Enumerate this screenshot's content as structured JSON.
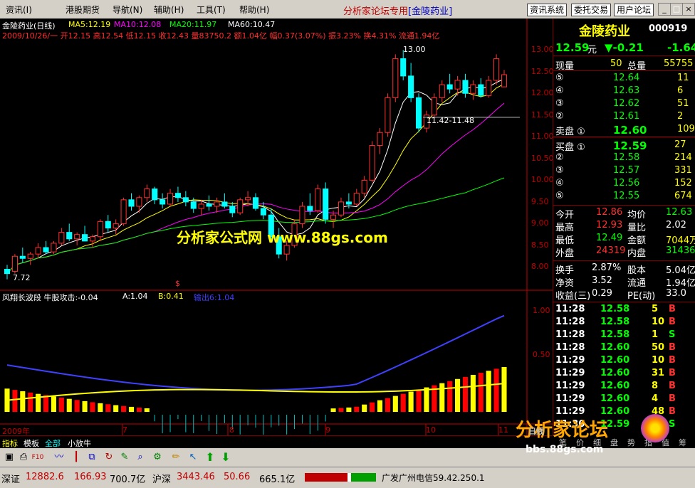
{
  "menubar": {
    "items": [
      "资讯(I)",
      "港股期货",
      "导航(N)",
      "辅助(H)",
      "工具(T)",
      "帮助(H)"
    ],
    "center_title": "分析家论坛专用",
    "center_stock": "[金陵药业]",
    "buttons": [
      "资讯系统",
      "委托交易",
      "用户论坛"
    ]
  },
  "chart": {
    "title": "金陵药业(日线)",
    "ma": [
      {
        "label": "MA5:12.19",
        "color": "#ffffff"
      },
      {
        "label": "MA10:12.08",
        "color": "#ffff00"
      },
      {
        "label": "MA20:11.97",
        "color": "#ff00ff"
      },
      {
        "label": "MA60:10.47",
        "color": "#00ff00"
      }
    ],
    "info_line": "2009/10/26/一 开12.15 高12.54 低12.15 收12.43 量83750.2 额1.04亿 幅0.37(3.07%) 振3.23% 换4.31% 流通1.94亿",
    "annotations": {
      "high": "13.00",
      "low": "7.72",
      "range": "11.42-11.48",
      "mark": "$"
    },
    "price_ticks": [
      "13.00",
      "12.50",
      "12.00",
      "11.50",
      "11.00",
      "10.50",
      "10.00",
      "9.50",
      "9.00",
      "8.50",
      "8.00"
    ],
    "indicator_title": "风翔长波段  牛股攻击:-0.04",
    "indicator_a": "A:1.04",
    "indicator_b": "B:0.41",
    "indicator_c": "输出6:1.04",
    "indicator_ticks": [
      "1.00",
      "0.50"
    ],
    "date_labels": [
      "2009年",
      "7",
      "8",
      "9",
      "10",
      "11"
    ],
    "watermark_center": "分析家公式网 www.88gs.com",
    "chart_data": {
      "type": "candlestick",
      "title": "金陵药业(日线)",
      "ylim": [
        7.5,
        13.2
      ],
      "candles_ohlc": [
        [
          7.95,
          8.05,
          7.72,
          7.85
        ],
        [
          7.9,
          8.3,
          7.85,
          8.25
        ],
        [
          8.25,
          8.45,
          8.1,
          8.2
        ],
        [
          8.2,
          8.35,
          8.05,
          8.3
        ],
        [
          8.3,
          8.55,
          8.2,
          8.45
        ],
        [
          8.45,
          8.6,
          8.3,
          8.35
        ],
        [
          8.35,
          8.6,
          8.3,
          8.55
        ],
        [
          8.55,
          8.9,
          8.5,
          8.8
        ],
        [
          8.8,
          9.0,
          8.6,
          8.65
        ],
        [
          8.65,
          8.8,
          8.5,
          8.75
        ],
        [
          8.75,
          8.95,
          8.65,
          8.6
        ],
        [
          8.6,
          8.75,
          8.45,
          8.7
        ],
        [
          8.7,
          9.1,
          8.6,
          9.05
        ],
        [
          9.05,
          9.2,
          8.8,
          8.9
        ],
        [
          8.9,
          9.1,
          8.75,
          9.0
        ],
        [
          9.0,
          9.6,
          8.95,
          9.55
        ],
        [
          9.55,
          9.7,
          9.3,
          9.4
        ],
        [
          9.4,
          9.65,
          9.25,
          9.6
        ],
        [
          9.6,
          9.9,
          9.5,
          9.8
        ],
        [
          9.8,
          9.85,
          9.45,
          9.55
        ],
        [
          9.55,
          9.7,
          9.35,
          9.45
        ],
        [
          9.45,
          9.8,
          9.4,
          9.7
        ],
        [
          9.7,
          9.85,
          9.5,
          9.6
        ],
        [
          9.6,
          9.75,
          9.4,
          9.5
        ],
        [
          9.5,
          9.6,
          9.25,
          9.35
        ],
        [
          9.35,
          9.55,
          9.2,
          9.45
        ],
        [
          9.45,
          9.65,
          9.3,
          9.4
        ],
        [
          9.4,
          9.6,
          9.25,
          9.5
        ],
        [
          9.5,
          9.7,
          9.35,
          9.4
        ],
        [
          9.4,
          9.5,
          9.15,
          9.25
        ],
        [
          9.25,
          9.6,
          9.2,
          9.55
        ],
        [
          9.55,
          9.75,
          9.4,
          9.6
        ],
        [
          9.6,
          9.7,
          9.3,
          9.35
        ],
        [
          9.35,
          9.5,
          9.1,
          9.2
        ],
        [
          9.2,
          9.35,
          8.6,
          8.7
        ],
        [
          8.7,
          8.9,
          8.2,
          8.3
        ],
        [
          8.3,
          8.6,
          8.15,
          8.5
        ],
        [
          8.5,
          9.1,
          8.45,
          9.0
        ],
        [
          9.0,
          9.5,
          8.9,
          9.4
        ],
        [
          9.4,
          9.7,
          9.2,
          9.3
        ],
        [
          9.3,
          9.9,
          9.25,
          9.8
        ],
        [
          9.8,
          9.95,
          9.0,
          9.1
        ],
        [
          9.1,
          9.3,
          8.9,
          9.2
        ],
        [
          9.2,
          9.6,
          9.15,
          9.5
        ],
        [
          9.5,
          9.7,
          9.35,
          9.45
        ],
        [
          9.45,
          9.8,
          9.4,
          9.7
        ],
        [
          9.7,
          10.1,
          9.6,
          10.0
        ],
        [
          10.0,
          10.9,
          9.95,
          10.8
        ],
        [
          10.8,
          11.2,
          10.6,
          11.1
        ],
        [
          11.1,
          12.0,
          11.0,
          11.9
        ],
        [
          11.9,
          12.9,
          11.8,
          12.8
        ],
        [
          12.8,
          13.0,
          12.3,
          12.4
        ],
        [
          12.4,
          12.7,
          11.8,
          11.9
        ],
        [
          11.9,
          12.0,
          11.1,
          11.2
        ],
        [
          11.2,
          11.6,
          11.1,
          11.5
        ],
        [
          11.5,
          12.0,
          11.42,
          11.9
        ],
        [
          11.9,
          12.3,
          11.8,
          12.2
        ],
        [
          12.2,
          12.45,
          12.0,
          12.1
        ],
        [
          12.1,
          12.4,
          11.95,
          12.3
        ],
        [
          12.3,
          12.45,
          11.9,
          12.0
        ],
        [
          12.0,
          12.3,
          11.85,
          12.2
        ],
        [
          12.2,
          12.35,
          11.9,
          11.95
        ],
        [
          11.95,
          12.4,
          11.9,
          12.3
        ],
        [
          12.3,
          12.9,
          12.2,
          12.8
        ],
        [
          12.15,
          12.54,
          12.15,
          12.43
        ]
      ]
    }
  },
  "quote": {
    "name": "金陵药业",
    "code": "000919",
    "price": "12.59",
    "unit": "元",
    "change": "▼-0.21",
    "change_pct": "-1.64",
    "now_label": "现量",
    "now_val": "50",
    "total_label": "总量",
    "total_val": "55755",
    "sell": [
      {
        "label": "⑤",
        "price": "12.64",
        "vol": "11"
      },
      {
        "label": "④",
        "price": "12.63",
        "vol": "6"
      },
      {
        "label": "③",
        "price": "12.62",
        "vol": "51"
      },
      {
        "label": "②",
        "price": "12.61",
        "vol": "2"
      },
      {
        "label": "卖盘 ①",
        "price": "12.60",
        "vol": "109"
      }
    ],
    "buy": [
      {
        "label": "买盘 ①",
        "price": "12.59",
        "vol": "27"
      },
      {
        "label": "②",
        "price": "12.58",
        "vol": "214"
      },
      {
        "label": "③",
        "price": "12.57",
        "vol": "331"
      },
      {
        "label": "④",
        "price": "12.56",
        "vol": "152"
      },
      {
        "label": "⑤",
        "price": "12.55",
        "vol": "674"
      }
    ],
    "stats": [
      {
        "l1": "今开",
        "v1": "12.86",
        "l2": "均价",
        "v2": "12.63"
      },
      {
        "l1": "最高",
        "v1": "12.93",
        "l2": "量比",
        "v2": "2.02"
      },
      {
        "l1": "最低",
        "v1": "12.49",
        "l2": "金额",
        "v2": "7044万"
      },
      {
        "l1": "外盘",
        "v1": "24319",
        "l2": "内盘",
        "v2": "31436"
      }
    ],
    "stats2": [
      {
        "l1": "换手",
        "v1": "2.87%",
        "l2": "股本",
        "v2": "5.04亿"
      },
      {
        "l1": "净资",
        "v1": "3.52",
        "l2": "流通",
        "v2": "1.94亿"
      },
      {
        "l1": "收益(三)",
        "v1": "0.29",
        "l2": "PE(动)",
        "v2": "33.0"
      }
    ],
    "ticks": [
      {
        "time": "11:28",
        "price": "12.58",
        "vol": "5",
        "side": "B"
      },
      {
        "time": "11:28",
        "price": "12.58",
        "vol": "10",
        "side": "B"
      },
      {
        "time": "11:28",
        "price": "12.58",
        "vol": "1",
        "side": "S"
      },
      {
        "time": "11:28",
        "price": "12.60",
        "vol": "50",
        "side": "B"
      },
      {
        "time": "11:29",
        "price": "12.60",
        "vol": "10",
        "side": "B"
      },
      {
        "time": "11:29",
        "price": "12.60",
        "vol": "31",
        "side": "B"
      },
      {
        "time": "11:29",
        "price": "12.60",
        "vol": "8",
        "side": "B"
      },
      {
        "time": "11:29",
        "price": "12.60",
        "vol": "4",
        "side": "B"
      },
      {
        "time": "11:29",
        "price": "12.60",
        "vol": "48",
        "side": "B"
      },
      {
        "time": "11:30",
        "price": "12.59",
        "vol": "50",
        "side": "S"
      }
    ],
    "bottom_tabs": [
      "笔",
      "价",
      "细",
      "盘",
      "势",
      "指",
      "值",
      "筹"
    ]
  },
  "tabs": [
    "指标",
    "模板",
    "全部",
    "小放牛"
  ],
  "toolbar_icons": [
    "save-icon",
    "print-icon",
    "f10-icon",
    "line-chart-icon",
    "candle-icon",
    "compare-icon",
    "refresh-icon",
    "pen-icon",
    "search-icon",
    "up-arrow-icon",
    "down-arrow-icon"
  ],
  "status": {
    "sz_label": "深证",
    "sz_index": "12882.6",
    "sz_change": "166.93",
    "sz_amount": "700.7亿",
    "hs_label": "沪深",
    "hs_index": "3443.46",
    "hs_change": "50.66",
    "hs_amount": "665.1亿",
    "server": "广发广州电信59.42.250.1"
  },
  "watermark": {
    "logo": "分析家论坛",
    "url": "bbs.88gs.com",
    "mode": "日线"
  }
}
